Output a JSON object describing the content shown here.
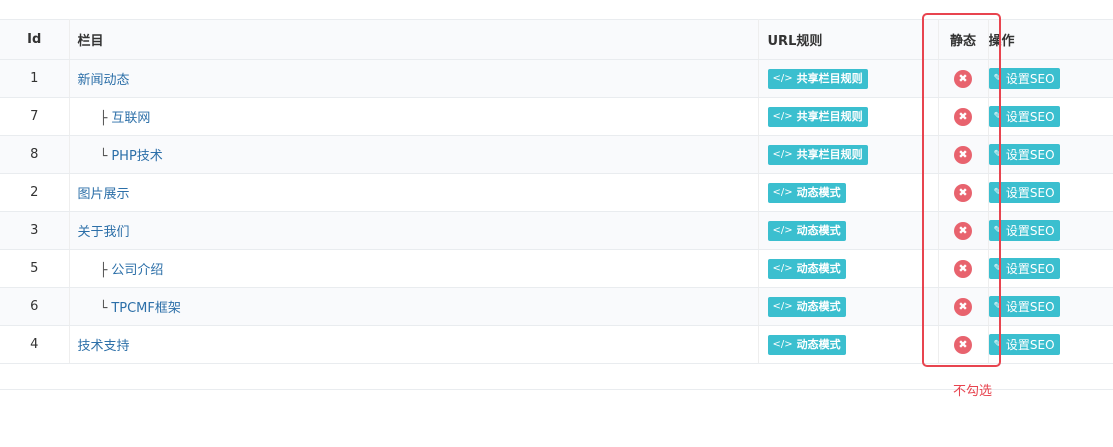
{
  "table": {
    "headers": {
      "id": "Id",
      "name": "栏目",
      "url_rule": "URL规则",
      "static": "静态",
      "operation": "操作"
    },
    "rows": [
      {
        "id": "1",
        "level": 0,
        "prefix": "",
        "name": "新闻动态",
        "url_rule": "共享栏目规则",
        "static": "✖",
        "operation": "设置SEO"
      },
      {
        "id": "7",
        "level": 1,
        "prefix": "├",
        "name": "互联网",
        "url_rule": "共享栏目规则",
        "static": "✖",
        "operation": "设置SEO"
      },
      {
        "id": "8",
        "level": 1,
        "prefix": "└",
        "name": "PHP技术",
        "url_rule": "共享栏目规则",
        "static": "✖",
        "operation": "设置SEO"
      },
      {
        "id": "2",
        "level": 0,
        "prefix": "",
        "name": "图片展示",
        "url_rule": "动态模式",
        "static": "✖",
        "operation": "设置SEO"
      },
      {
        "id": "3",
        "level": 0,
        "prefix": "",
        "name": "关于我们",
        "url_rule": "动态模式",
        "static": "✖",
        "operation": "设置SEO"
      },
      {
        "id": "5",
        "level": 1,
        "prefix": "├",
        "name": "公司介绍",
        "url_rule": "动态模式",
        "static": "✖",
        "operation": "设置SEO"
      },
      {
        "id": "6",
        "level": 1,
        "prefix": "└",
        "name": "TPCMF框架",
        "url_rule": "动态模式",
        "static": "✖",
        "operation": "设置SEO"
      },
      {
        "id": "4",
        "level": 0,
        "prefix": "",
        "name": "技术支持",
        "url_rule": "动态模式",
        "static": "✖",
        "operation": "设置SEO"
      }
    ]
  },
  "icons": {
    "url_rule_icon": "</>",
    "seo_icon": "✎"
  },
  "annotation": {
    "text": "不勾选"
  },
  "colors": {
    "link": "#2c6fa8",
    "button": "#3bbfcf",
    "status_off": "#e8636e",
    "highlight": "#e8444f"
  }
}
